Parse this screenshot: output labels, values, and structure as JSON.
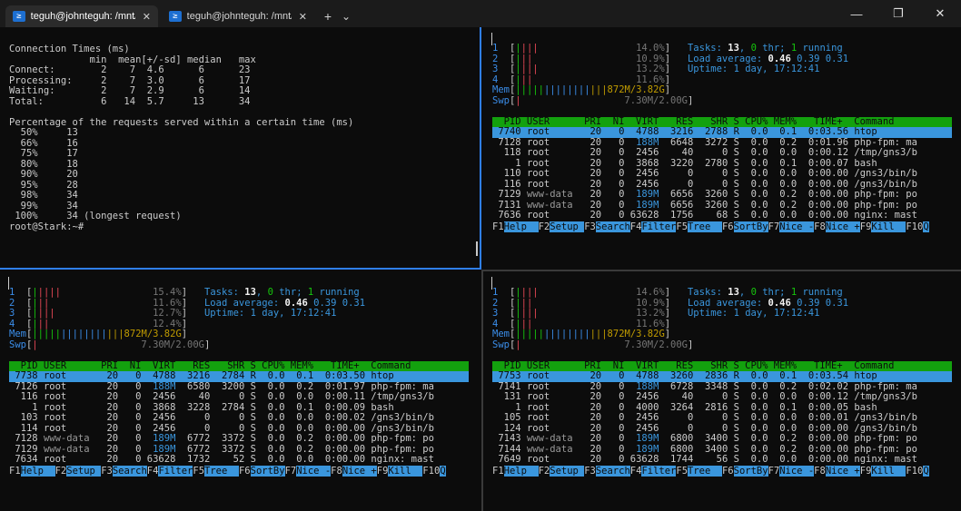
{
  "tabs": [
    {
      "title": "teguh@johnteguh: /mnt/c/Us",
      "active": true
    },
    {
      "title": "teguh@johnteguh: /mnt/c/Use",
      "active": false
    }
  ],
  "tab_close": "✕",
  "new_tab": "+",
  "dropdown": "⌄",
  "window": {
    "minimize": "—",
    "maximize": "❐",
    "close": "✕"
  },
  "ps_glyph": "≥",
  "ab": {
    "lines": [
      "Connection Times (ms)",
      "              min  mean[+/-sd] median   max",
      "Connect:        2    7  4.6      6      23",
      "Processing:     2    7  3.0      6      17",
      "Waiting:        2    7  2.9      6      14",
      "Total:          6   14  5.7     13      34",
      "",
      "Percentage of the requests served within a certain time (ms)",
      "  50%     13",
      "  66%     16",
      "  75%     17",
      "  80%     18",
      "  90%     20",
      "  95%     28",
      "  98%     34",
      "  99%     34",
      " 100%     34 (longest request)",
      "root@Stark:~#"
    ]
  },
  "htop_panes": [
    {
      "id": "tr",
      "cpu": [
        {
          "n": "1",
          "bars": "||||",
          "pct": "14.0%"
        },
        {
          "n": "2",
          "bars": "|||",
          "pct": "10.9%"
        },
        {
          "n": "3",
          "bars": "||||",
          "pct": "13.2%"
        },
        {
          "n": "4",
          "bars": "|||",
          "pct": "11.6%"
        }
      ],
      "mem": {
        "label": "Mem",
        "bars": "||||||||||||||||",
        "value": "872M/3.82G"
      },
      "swp": {
        "label": "Swp",
        "bars": "|",
        "value": "7.30M/2.00G"
      },
      "tasks": {
        "prefix": "Tasks: ",
        "count": "13",
        "sep1": ", ",
        "thr": "0",
        "thr_label": " thr; ",
        "running": "1",
        "running_label": " running"
      },
      "load": {
        "prefix": "Load average: ",
        "v1": "0.46",
        "v2": "0.39",
        "v3": "0.31"
      },
      "uptime": {
        "prefix": "Uptime: ",
        "value": "1 day, 17:12:41"
      },
      "header": "  PID USER      PRI  NI  VIRT   RES   SHR S CPU% MEM%   TIME+  Command",
      "rows": [
        {
          "pid": " 7740",
          "user": "root    ",
          "pri": "20",
          "ni": " 0",
          "virt": " 4788",
          "res": " 3216",
          "shr": " 2788",
          "s": "R",
          "cpu": " 0.0",
          "mem": " 0.1",
          "time": " 0:03.56",
          "cmd": "htop",
          "sel": true
        },
        {
          "pid": " 7128",
          "user": "root    ",
          "pri": "20",
          "ni": " 0",
          "virt": " 188M",
          "res": " 6648",
          "shr": " 3272",
          "s": "S",
          "cpu": " 0.0",
          "mem": " 0.2",
          "time": " 0:01.96",
          "cmd": "php-fpm: ma"
        },
        {
          "pid": "  118",
          "user": "root    ",
          "pri": "20",
          "ni": " 0",
          "virt": " 2456",
          "res": "   40",
          "shr": "    0",
          "s": "S",
          "cpu": " 0.0",
          "mem": " 0.0",
          "time": " 0:00.12",
          "cmd": "/tmp/gns3/b"
        },
        {
          "pid": "    1",
          "user": "root    ",
          "pri": "20",
          "ni": " 0",
          "virt": " 3868",
          "res": " 3220",
          "shr": " 2780",
          "s": "S",
          "cpu": " 0.0",
          "mem": " 0.1",
          "time": " 0:00.07",
          "cmd": "bash"
        },
        {
          "pid": "  110",
          "user": "root    ",
          "pri": "20",
          "ni": " 0",
          "virt": " 2456",
          "res": "    0",
          "shr": "    0",
          "s": "S",
          "cpu": " 0.0",
          "mem": " 0.0",
          "time": " 0:00.00",
          "cmd": "/gns3/bin/b"
        },
        {
          "pid": "  116",
          "user": "root    ",
          "pri": "20",
          "ni": " 0",
          "virt": " 2456",
          "res": "    0",
          "shr": "    0",
          "s": "S",
          "cpu": " 0.0",
          "mem": " 0.0",
          "time": " 0:00.00",
          "cmd": "/gns3/bin/b"
        },
        {
          "pid": " 7129",
          "user": "www-data",
          "pri": "20",
          "ni": " 0",
          "virt": " 189M",
          "res": " 6656",
          "shr": " 3260",
          "s": "S",
          "cpu": " 0.0",
          "mem": " 0.2",
          "time": " 0:00.00",
          "cmd": "php-fpm: po"
        },
        {
          "pid": " 7131",
          "user": "www-data",
          "pri": "20",
          "ni": " 0",
          "virt": " 189M",
          "res": " 6656",
          "shr": " 3260",
          "s": "S",
          "cpu": " 0.0",
          "mem": " 0.2",
          "time": " 0:00.00",
          "cmd": "php-fpm: po"
        },
        {
          "pid": " 7636",
          "user": "root    ",
          "pri": "20",
          "ni": " 0",
          "virt": "63628",
          "res": " 1756",
          "shr": "   68",
          "s": "S",
          "cpu": " 0.0",
          "mem": " 0.0",
          "time": " 0:00.00",
          "cmd": "nginx: mast"
        }
      ]
    },
    {
      "id": "bl",
      "cpu": [
        {
          "n": "1",
          "bars": "|||||",
          "pct": "15.4%"
        },
        {
          "n": "2",
          "bars": "|||",
          "pct": "11.6%"
        },
        {
          "n": "3",
          "bars": "||||",
          "pct": "12.7%"
        },
        {
          "n": "4",
          "bars": "|||",
          "pct": "12.4%"
        }
      ],
      "mem": {
        "label": "Mem",
        "bars": "||||||||||||||||",
        "value": "872M/3.82G"
      },
      "swp": {
        "label": "Swp",
        "bars": "|",
        "value": "7.30M/2.00G"
      },
      "tasks": {
        "prefix": "Tasks: ",
        "count": "13",
        "sep1": ", ",
        "thr": "0",
        "thr_label": " thr; ",
        "running": "1",
        "running_label": " running"
      },
      "load": {
        "prefix": "Load average: ",
        "v1": "0.46",
        "v2": "0.39",
        "v3": "0.31"
      },
      "uptime": {
        "prefix": "Uptime: ",
        "value": "1 day, 17:12:41"
      },
      "header": "  PID USER      PRI  NI  VIRT   RES   SHR S CPU% MEM%   TIME+  Command",
      "rows": [
        {
          "pid": " 7738",
          "user": "root    ",
          "pri": "20",
          "ni": " 0",
          "virt": " 4788",
          "res": " 3216",
          "shr": " 2784",
          "s": "R",
          "cpu": " 0.0",
          "mem": " 0.1",
          "time": " 0:03.50",
          "cmd": "htop",
          "sel": true
        },
        {
          "pid": " 7126",
          "user": "root    ",
          "pri": "20",
          "ni": " 0",
          "virt": " 188M",
          "res": " 6580",
          "shr": " 3200",
          "s": "S",
          "cpu": " 0.0",
          "mem": " 0.2",
          "time": " 0:01.97",
          "cmd": "php-fpm: ma"
        },
        {
          "pid": "  116",
          "user": "root    ",
          "pri": "20",
          "ni": " 0",
          "virt": " 2456",
          "res": "   40",
          "shr": "    0",
          "s": "S",
          "cpu": " 0.0",
          "mem": " 0.0",
          "time": " 0:00.11",
          "cmd": "/tmp/gns3/b"
        },
        {
          "pid": "    1",
          "user": "root    ",
          "pri": "20",
          "ni": " 0",
          "virt": " 3868",
          "res": " 3228",
          "shr": " 2784",
          "s": "S",
          "cpu": " 0.0",
          "mem": " 0.1",
          "time": " 0:00.09",
          "cmd": "bash"
        },
        {
          "pid": "  103",
          "user": "root    ",
          "pri": "20",
          "ni": " 0",
          "virt": " 2456",
          "res": "    0",
          "shr": "    0",
          "s": "S",
          "cpu": " 0.0",
          "mem": " 0.0",
          "time": " 0:00.02",
          "cmd": "/gns3/bin/b"
        },
        {
          "pid": "  114",
          "user": "root    ",
          "pri": "20",
          "ni": " 0",
          "virt": " 2456",
          "res": "    0",
          "shr": "    0",
          "s": "S",
          "cpu": " 0.0",
          "mem": " 0.0",
          "time": " 0:00.00",
          "cmd": "/gns3/bin/b"
        },
        {
          "pid": " 7128",
          "user": "www-data",
          "pri": "20",
          "ni": " 0",
          "virt": " 189M",
          "res": " 6772",
          "shr": " 3372",
          "s": "S",
          "cpu": " 0.0",
          "mem": " 0.2",
          "time": " 0:00.00",
          "cmd": "php-fpm: po"
        },
        {
          "pid": " 7129",
          "user": "www-data",
          "pri": "20",
          "ni": " 0",
          "virt": " 189M",
          "res": " 6772",
          "shr": " 3372",
          "s": "S",
          "cpu": " 0.0",
          "mem": " 0.2",
          "time": " 0:00.00",
          "cmd": "php-fpm: po"
        },
        {
          "pid": " 7634",
          "user": "root    ",
          "pri": "20",
          "ni": " 0",
          "virt": "63628",
          "res": " 1732",
          "shr": "   52",
          "s": "S",
          "cpu": " 0.0",
          "mem": " 0.0",
          "time": " 0:00.00",
          "cmd": "nginx: mast"
        }
      ]
    },
    {
      "id": "br",
      "cpu": [
        {
          "n": "1",
          "bars": "||||",
          "pct": "14.6%"
        },
        {
          "n": "2",
          "bars": "|||",
          "pct": "10.9%"
        },
        {
          "n": "3",
          "bars": "||||",
          "pct": "13.2%"
        },
        {
          "n": "4",
          "bars": "|||",
          "pct": "11.6%"
        }
      ],
      "mem": {
        "label": "Mem",
        "bars": "||||||||||||||||",
        "value": "872M/3.82G"
      },
      "swp": {
        "label": "Swp",
        "bars": "|",
        "value": "7.30M/2.00G"
      },
      "tasks": {
        "prefix": "Tasks: ",
        "count": "13",
        "sep1": ", ",
        "thr": "0",
        "thr_label": " thr; ",
        "running": "1",
        "running_label": " running"
      },
      "load": {
        "prefix": "Load average: ",
        "v1": "0.46",
        "v2": "0.39",
        "v3": "0.31"
      },
      "uptime": {
        "prefix": "Uptime: ",
        "value": "1 day, 17:12:41"
      },
      "header": "  PID USER      PRI  NI  VIRT   RES   SHR S CPU% MEM%   TIME+  Command",
      "rows": [
        {
          "pid": " 7753",
          "user": "root    ",
          "pri": "20",
          "ni": " 0",
          "virt": " 4788",
          "res": " 3260",
          "shr": " 2836",
          "s": "R",
          "cpu": " 0.0",
          "mem": " 0.1",
          "time": " 0:03.54",
          "cmd": "htop",
          "sel": true
        },
        {
          "pid": " 7141",
          "user": "root    ",
          "pri": "20",
          "ni": " 0",
          "virt": " 188M",
          "res": " 6728",
          "shr": " 3348",
          "s": "S",
          "cpu": " 0.0",
          "mem": " 0.2",
          "time": " 0:02.02",
          "cmd": "php-fpm: ma"
        },
        {
          "pid": "  131",
          "user": "root    ",
          "pri": "20",
          "ni": " 0",
          "virt": " 2456",
          "res": "   40",
          "shr": "    0",
          "s": "S",
          "cpu": " 0.0",
          "mem": " 0.0",
          "time": " 0:00.12",
          "cmd": "/tmp/gns3/b"
        },
        {
          "pid": "    1",
          "user": "root    ",
          "pri": "20",
          "ni": " 0",
          "virt": " 4000",
          "res": " 3264",
          "shr": " 2816",
          "s": "S",
          "cpu": " 0.0",
          "mem": " 0.1",
          "time": " 0:00.05",
          "cmd": "bash"
        },
        {
          "pid": "  105",
          "user": "root    ",
          "pri": "20",
          "ni": " 0",
          "virt": " 2456",
          "res": "    0",
          "shr": "    0",
          "s": "S",
          "cpu": " 0.0",
          "mem": " 0.0",
          "time": " 0:00.01",
          "cmd": "/gns3/bin/b"
        },
        {
          "pid": "  124",
          "user": "root    ",
          "pri": "20",
          "ni": " 0",
          "virt": " 2456",
          "res": "    0",
          "shr": "    0",
          "s": "S",
          "cpu": " 0.0",
          "mem": " 0.0",
          "time": " 0:00.00",
          "cmd": "/gns3/bin/b"
        },
        {
          "pid": " 7143",
          "user": "www-data",
          "pri": "20",
          "ni": " 0",
          "virt": " 189M",
          "res": " 6800",
          "shr": " 3400",
          "s": "S",
          "cpu": " 0.0",
          "mem": " 0.2",
          "time": " 0:00.00",
          "cmd": "php-fpm: po"
        },
        {
          "pid": " 7144",
          "user": "www-data",
          "pri": "20",
          "ni": " 0",
          "virt": " 189M",
          "res": " 6800",
          "shr": " 3400",
          "s": "S",
          "cpu": " 0.0",
          "mem": " 0.2",
          "time": " 0:00.00",
          "cmd": "php-fpm: po"
        },
        {
          "pid": " 7649",
          "user": "root    ",
          "pri": "20",
          "ni": " 0",
          "virt": "63628",
          "res": " 1744",
          "shr": "   56",
          "s": "S",
          "cpu": " 0.0",
          "mem": " 0.0",
          "time": " 0:00.00",
          "cmd": "nginx: mast"
        }
      ]
    }
  ],
  "fkeys": [
    {
      "key": "F1",
      "label": "Help  "
    },
    {
      "key": "F2",
      "label": "Setup "
    },
    {
      "key": "F3",
      "label": "Search"
    },
    {
      "key": "F4",
      "label": "Filter"
    },
    {
      "key": "F5",
      "label": "Tree  "
    },
    {
      "key": "F6",
      "label": "SortBy"
    },
    {
      "key": "F7",
      "label": "Nice -"
    },
    {
      "key": "F8",
      "label": "Nice +"
    },
    {
      "key": "F9",
      "label": "Kill  "
    },
    {
      "key": "F10",
      "label": "Q"
    }
  ],
  "colors": {
    "accent": "#2f7ff0",
    "htop_header_bg": "#13a10e",
    "htop_selected_bg": "#3a96dd",
    "bar_red": "#e74856",
    "bar_green": "#16c60c",
    "bar_yellow": "#c19c00",
    "label_blue": "#3b8eea"
  }
}
